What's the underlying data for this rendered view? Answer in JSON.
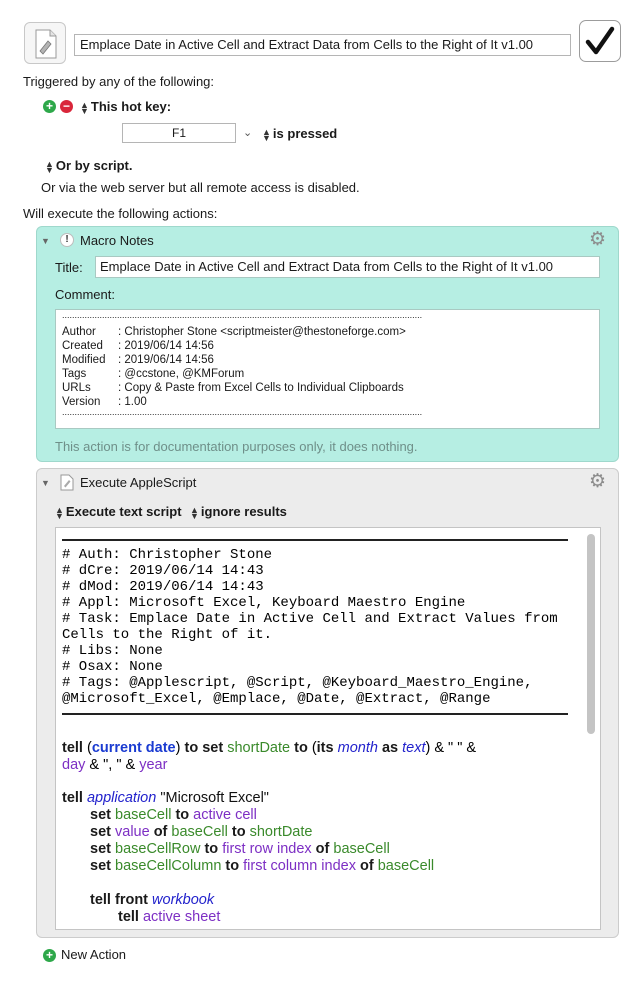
{
  "header": {
    "macro_name": "Emplace Date in Active Cell and Extract Data from Cells to the Right of It v1.00"
  },
  "triggers": {
    "intro": "Triggered by any of the following:",
    "hotkey_type": "This hot key:",
    "hotkey_value": "F1",
    "hotkey_condition": "is pressed",
    "script_trigger": "Or by script.",
    "web_server_note": "Or via the web server but all remote access is disabled."
  },
  "actions_intro": "Will execute the following actions:",
  "notes_action": {
    "title": "Macro Notes",
    "title_label": "Title:",
    "title_value": "Emplace Date in Active Cell and Extract Data from Cells to the Right of It v1.00",
    "comment_label": "Comment:",
    "comment_rule": "................................................................................................................................................",
    "comment_rows": [
      {
        "key": "Author",
        "value": ": Christopher Stone <scriptmeister@thestoneforge.com>"
      },
      {
        "key": "Created",
        "value": ": 2019/06/14 14:56"
      },
      {
        "key": "Modified",
        "value": ": 2019/06/14 14:56"
      },
      {
        "key": "Tags",
        "value": ": @ccstone, @KMForum"
      },
      {
        "key": "URLs",
        "value": ": Copy & Paste from Excel Cells to Individual Clipboards"
      },
      {
        "key": "Version",
        "value": ": 1.00"
      }
    ],
    "footer": "This action is for documentation purposes only, it does nothing."
  },
  "script_action": {
    "title": "Execute AppleScript",
    "mode": "Execute text script",
    "results": "ignore results",
    "header_comments": [
      "# Auth: Christopher Stone",
      "# dCre: 2019/06/14 14:43",
      "# dMod: 2019/06/14 14:43",
      "# Appl: Microsoft Excel, Keyboard Maestro Engine",
      "# Task: Emplace Date in Active Cell and Extract Values from",
      "Cells to the Right of it.",
      "# Libs: None",
      "# Osax: None",
      "# Tags: @Applescript, @Script, @Keyboard_Maestro_Engine,",
      "@Microsoft_Excel, @Emplace, @Date, @Extract, @Range"
    ],
    "code": {
      "l1_tell": "tell",
      "l1_open": " (",
      "l1_current_date": "current date",
      "l1_close": ") ",
      "l1_to": "to",
      "l1_set": "set",
      "l1_shortDate": "shortDate",
      "l1_paren": " (",
      "l1_its": "its",
      "l1_month": "month",
      "l1_as": "as",
      "l1_text": "text",
      "l1_tail": ") & \" \" &",
      "l2_day": "day",
      "l2_mid": " & \", \" & ",
      "l2_year": "year",
      "l3_tell": "tell",
      "l3_application": "application",
      "l3_string": " \"Microsoft Excel\"",
      "l4_set": "set",
      "l4_baseCell": "baseCell",
      "l4_to": "to",
      "l4_active_cell": "active cell",
      "l5_set": "set",
      "l5_value": "value",
      "l5_of": "of",
      "l5_baseCell": "baseCell",
      "l5_to": "to",
      "l5_shortDate": "shortDate",
      "l6_set": "set",
      "l6_var": "baseCellRow",
      "l6_to": "to",
      "l6_prop": "first row index",
      "l6_of": "of",
      "l6_baseCell": "baseCell",
      "l7_set": "set",
      "l7_var": "baseCellColumn",
      "l7_to": "to",
      "l7_prop": "first column index",
      "l7_of": "of",
      "l7_baseCell": "baseCell",
      "l8_tell": "tell",
      "l8_front": "front",
      "l8_workbook": "workbook",
      "l9_tell": "tell",
      "l9_active_sheet": "active sheet"
    }
  },
  "new_action": "New Action",
  "colors": {
    "notes_bg": "#b6eee3",
    "script_bg": "#ececec",
    "variable": "#3a8a2b",
    "class": "#2222cc",
    "property": "#7d2fc4",
    "add": "#2ea84a",
    "remove": "#d9263a"
  }
}
